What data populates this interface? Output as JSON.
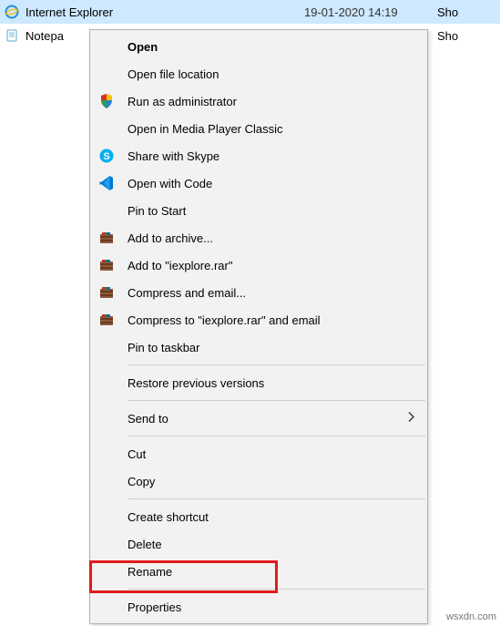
{
  "files": [
    {
      "name": "Internet Explorer",
      "date": "19-01-2020 14:19",
      "type": "Sho",
      "icon": "ie"
    },
    {
      "name": "Notepa",
      "date": "",
      "type": "Sho",
      "icon": "notepad"
    }
  ],
  "menu": {
    "open": "Open",
    "open_file_location": "Open file location",
    "run_as_admin": "Run as administrator",
    "open_mpc": "Open in Media Player Classic",
    "share_skype": "Share with Skype",
    "open_with_code": "Open with Code",
    "pin_start": "Pin to Start",
    "add_archive": "Add to archive...",
    "add_iexplore_rar": "Add to \"iexplore.rar\"",
    "compress_email": "Compress and email...",
    "compress_iexplore_email": "Compress to \"iexplore.rar\" and email",
    "pin_taskbar": "Pin to taskbar",
    "restore_previous": "Restore previous versions",
    "send_to": "Send to",
    "cut": "Cut",
    "copy": "Copy",
    "create_shortcut": "Create shortcut",
    "delete": "Delete",
    "rename": "Rename",
    "properties": "Properties"
  },
  "watermark": "wsxdn.com"
}
